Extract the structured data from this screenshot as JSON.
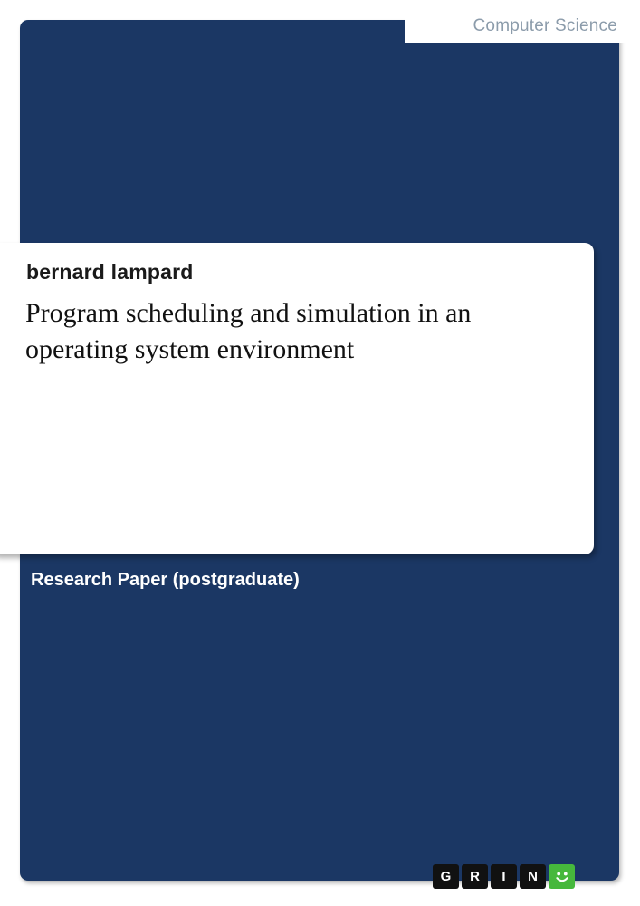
{
  "cover": {
    "category": "Computer Science",
    "author": "bernard lampard",
    "title": "Program scheduling and simulation in an operating system environment",
    "publication_type": "Research Paper (postgraduate)",
    "colors": {
      "panel_navy": "#1b3764",
      "card_white": "#ffffff",
      "category_gray": "#8c9cab",
      "logo_black": "#111111",
      "logo_green": "#46b83c"
    },
    "publisher_logo": {
      "name": "GRIN",
      "tiles": [
        "G",
        "R",
        "I",
        "N"
      ],
      "smiley_icon": "smiley-face-icon"
    }
  }
}
